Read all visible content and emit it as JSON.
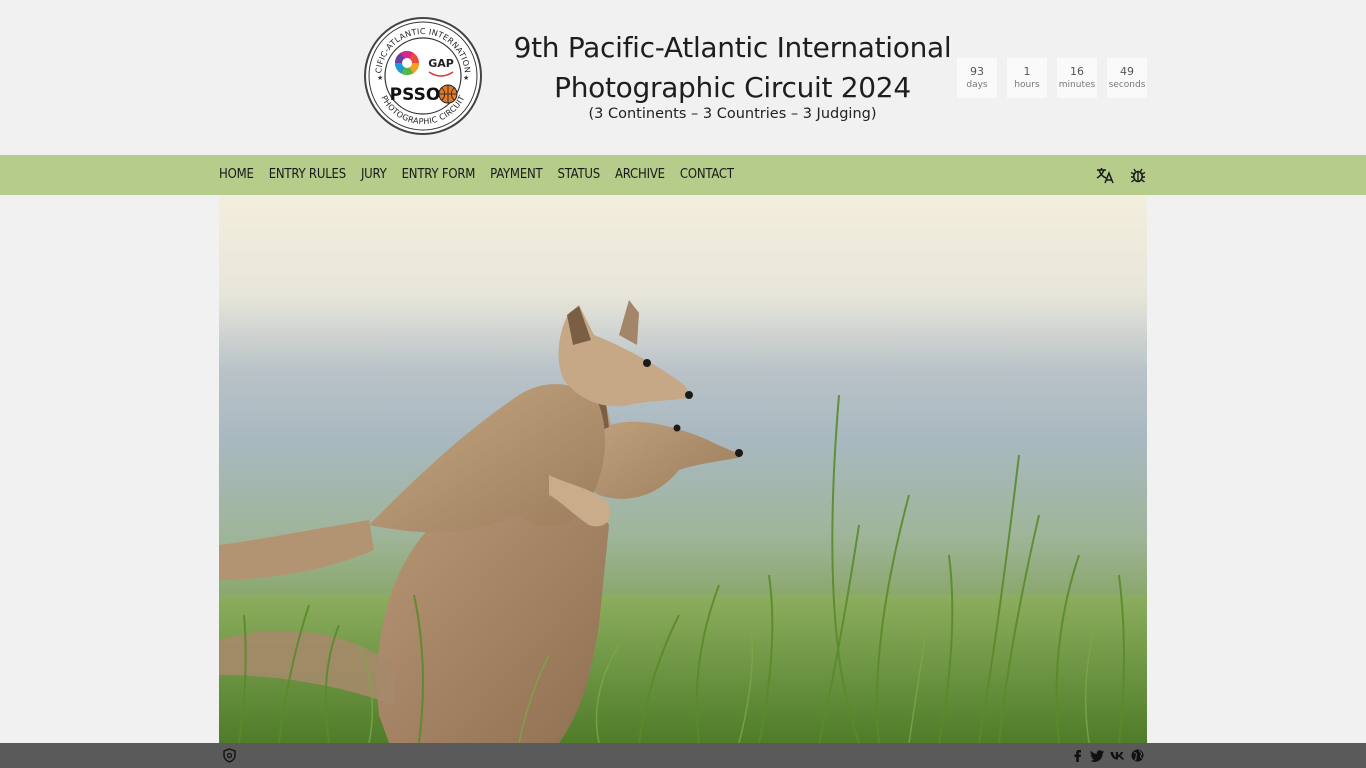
{
  "header": {
    "logo": {
      "ring_text_top": "PACIFIC-ATLANTIC INTERNATIONAL",
      "ring_text_bottom": "PHOTOGRAPHIC CIRCUIT",
      "badge_gap": "GAP",
      "badge_psso": "PSSO"
    },
    "title_line1": "9th Pacific-Atlantic International",
    "title_line2": "Photographic Circuit 2024",
    "subtitle": "(3 Continents – 3 Countries – 3 Judging)"
  },
  "countdown": [
    {
      "value": "93",
      "label": "days"
    },
    {
      "value": "1",
      "label": "hours"
    },
    {
      "value": "16",
      "label": "minutes"
    },
    {
      "value": "49",
      "label": "seconds"
    }
  ],
  "nav": {
    "items": [
      "HOME",
      "ENTRY RULES",
      "JURY",
      "ENTRY FORM",
      "PAYMENT",
      "STATUS",
      "ARCHIVE",
      "CONTACT"
    ],
    "icons": [
      "translate-icon",
      "bug-icon"
    ]
  },
  "hero": {
    "subject": "fox-kits-in-grass-photo"
  },
  "footer": {
    "left_icon": "privacy-shield-icon",
    "social_icons": [
      "facebook-icon",
      "twitter-icon",
      "vk-icon",
      "website-icon"
    ]
  },
  "colors": {
    "page_bg": "#f1f1f1",
    "nav_bg": "#b5cc8a",
    "footer_bg": "#5a5a5a",
    "text": "#1e1e1e"
  }
}
